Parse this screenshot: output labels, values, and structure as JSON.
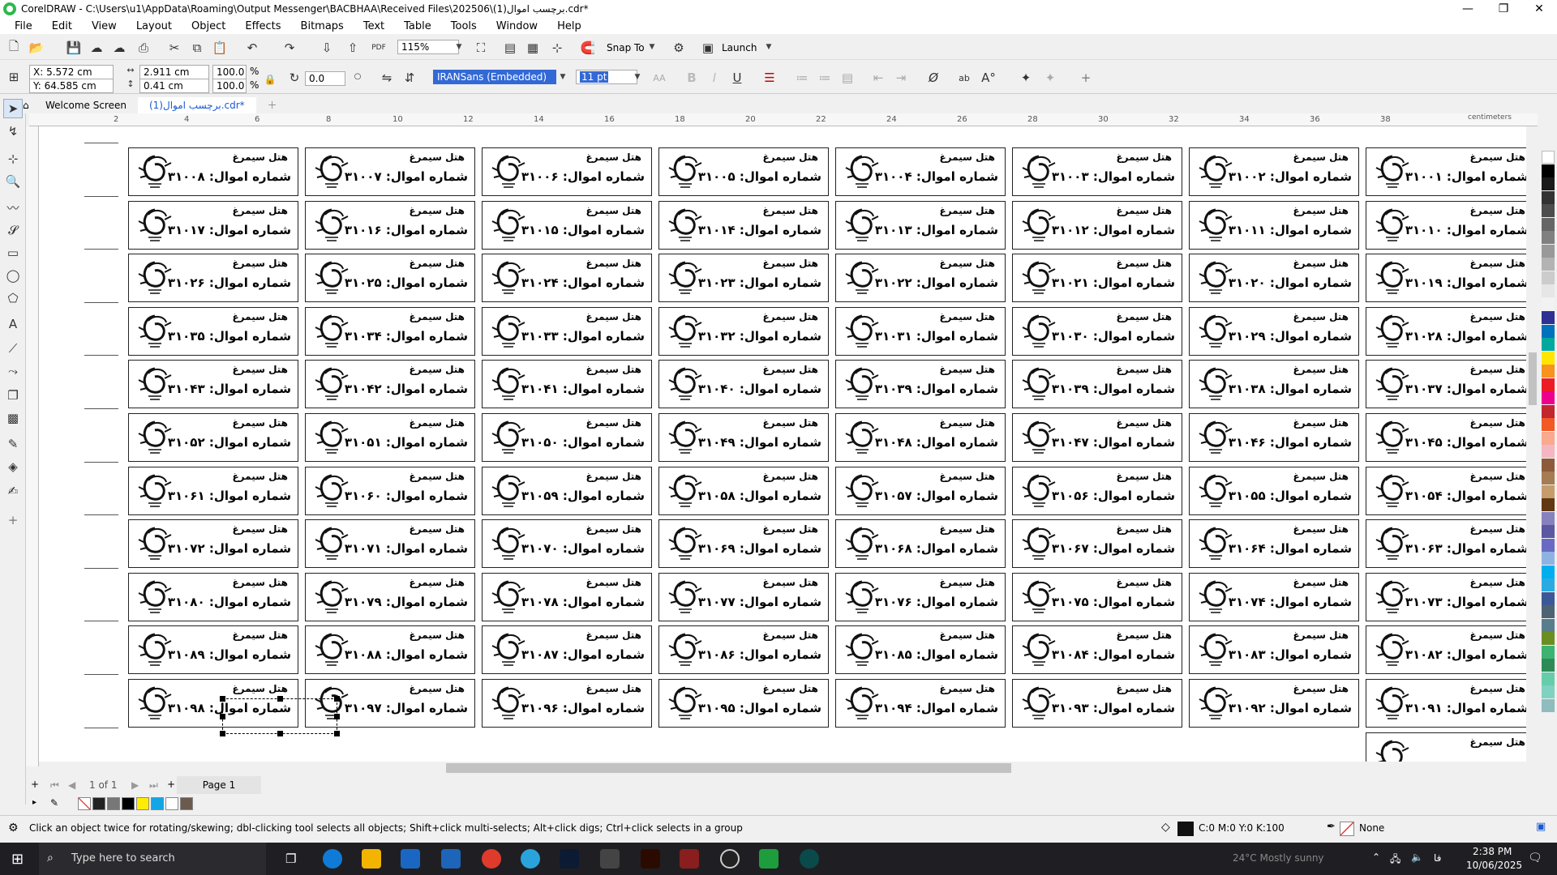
{
  "window": {
    "title": "CorelDRAW - C:\\Users\\u1\\AppData\\Roaming\\Output Messenger\\BACBHAA\\Received Files\\202506\\برچسب اموال(1).cdr*"
  },
  "menu": [
    "File",
    "Edit",
    "View",
    "Layout",
    "Object",
    "Effects",
    "Bitmaps",
    "Text",
    "Table",
    "Tools",
    "Window",
    "Help"
  ],
  "toolbar1": {
    "zoom": "115%",
    "snap_label": "Snap To",
    "launch_label": "Launch"
  },
  "toolbar2": {
    "x_value": "X: 5.572 cm",
    "y_value": "Y: 64.585 cm",
    "w_value": "2.911 cm",
    "h_value": "0.41 cm",
    "scale_x": "100.0",
    "scale_y": "100.0",
    "pct_x": "%",
    "pct_y": "%",
    "angle": "0.0",
    "font_name": "IRANSans (Embedded)",
    "font_size": "11 pt"
  },
  "doc_tabs": [
    "Welcome Screen",
    "برچسب اموال(1).cdr*"
  ],
  "ruler_h": [
    "2",
    "4",
    "6",
    "8",
    "10",
    "12",
    "14",
    "16",
    "18",
    "20",
    "22",
    "24",
    "26",
    "28",
    "30",
    "32",
    "34",
    "36",
    "38"
  ],
  "ruler_unit": "centimeters",
  "labels": {
    "hotel_name": "هتل سیمرغ",
    "asset_prefix": "شماره اموال:",
    "rows": [
      [
        "۳۱۰۰۸",
        "۳۱۰۰۷",
        "۳۱۰۰۶",
        "۳۱۰۰۵",
        "۳۱۰۰۴",
        "۳۱۰۰۳",
        "۳۱۰۰۲",
        "۳۱۰۰۱"
      ],
      [
        "۳۱۰۱۷",
        "۳۱۰۱۶",
        "۳۱۰۱۵",
        "۳۱۰۱۴",
        "۳۱۰۱۳",
        "۳۱۰۱۲",
        "۳۱۰۱۱",
        "۳۱۰۱۰"
      ],
      [
        "۳۱۰۲۶",
        "۳۱۰۲۵",
        "۳۱۰۲۴",
        "۳۱۰۲۳",
        "۳۱۰۲۲",
        "۳۱۰۲۱",
        "۳۱۰۲۰",
        "۳۱۰۱۹"
      ],
      [
        "۳۱۰۳۵",
        "۳۱۰۳۴",
        "۳۱۰۳۳",
        "۳۱۰۳۲",
        "۳۱۰۳۱",
        "۳۱۰۳۰",
        "۳۱۰۲۹",
        "۳۱۰۲۸"
      ],
      [
        "۳۱۰۴۳",
        "۳۱۰۴۲",
        "۳۱۰۴۱",
        "۳۱۰۴۰",
        "۳۱۰۳۹",
        "۳۱۰۳۹",
        "۳۱۰۳۸",
        "۳۱۰۳۷"
      ],
      [
        "۳۱۰۵۲",
        "۳۱۰۵۱",
        "۳۱۰۵۰",
        "۳۱۰۴۹",
        "۳۱۰۴۸",
        "۳۱۰۴۷",
        "۳۱۰۴۶",
        "۳۱۰۴۵"
      ],
      [
        "۳۱۰۶۱",
        "۳۱۰۶۰",
        "۳۱۰۵۹",
        "۳۱۰۵۸",
        "۳۱۰۵۷",
        "۳۱۰۵۶",
        "۳۱۰۵۵",
        "۳۱۰۵۴"
      ],
      [
        "۳۱۰۷۲",
        "۳۱۰۷۱",
        "۳۱۰۷۰",
        "۳۱۰۶۹",
        "۳۱۰۶۸",
        "۳۱۰۶۷",
        "۳۱۰۶۴",
        "۳۱۰۶۳"
      ],
      [
        "۳۱۰۸۰",
        "۳۱۰۷۹",
        "۳۱۰۷۸",
        "۳۱۰۷۷",
        "۳۱۰۷۶",
        "۳۱۰۷۵",
        "۳۱۰۷۴",
        "۳۱۰۷۳"
      ],
      [
        "۳۱۰۸۹",
        "۳۱۰۸۸",
        "۳۱۰۸۷",
        "۳۱۰۸۶",
        "۳۱۰۸۵",
        "۳۱۰۸۴",
        "۳۱۰۸۳",
        "۳۱۰۸۲"
      ],
      [
        "۳۱۰۹۸",
        "۳۱۰۹۷",
        "۳۱۰۹۶",
        "۳۱۰۹۵",
        "۳۱۰۹۴",
        "۳۱۰۹۳",
        "۳۱۰۹۲",
        "۳۱۰۹۱"
      ]
    ]
  },
  "page_nav": {
    "counter": "1 of 1",
    "page_tab": "Page 1"
  },
  "status": {
    "hint": "Click an object twice for rotating/skewing; dbl-clicking tool selects all objects; Shift+click multi-selects; Alt+click digs; Ctrl+click selects in a group",
    "fill": "C:0 M:0 Y:0 K:100",
    "outline": "None"
  },
  "taskbar": {
    "search_placeholder": "Type here to search",
    "weather": "24°C  Mostly sunny",
    "time": "2:38 PM",
    "date": "10/06/2025",
    "lang": "فا"
  },
  "colors": {
    "accent": "#1a5ad0",
    "selection_bg": "#3369d6"
  }
}
